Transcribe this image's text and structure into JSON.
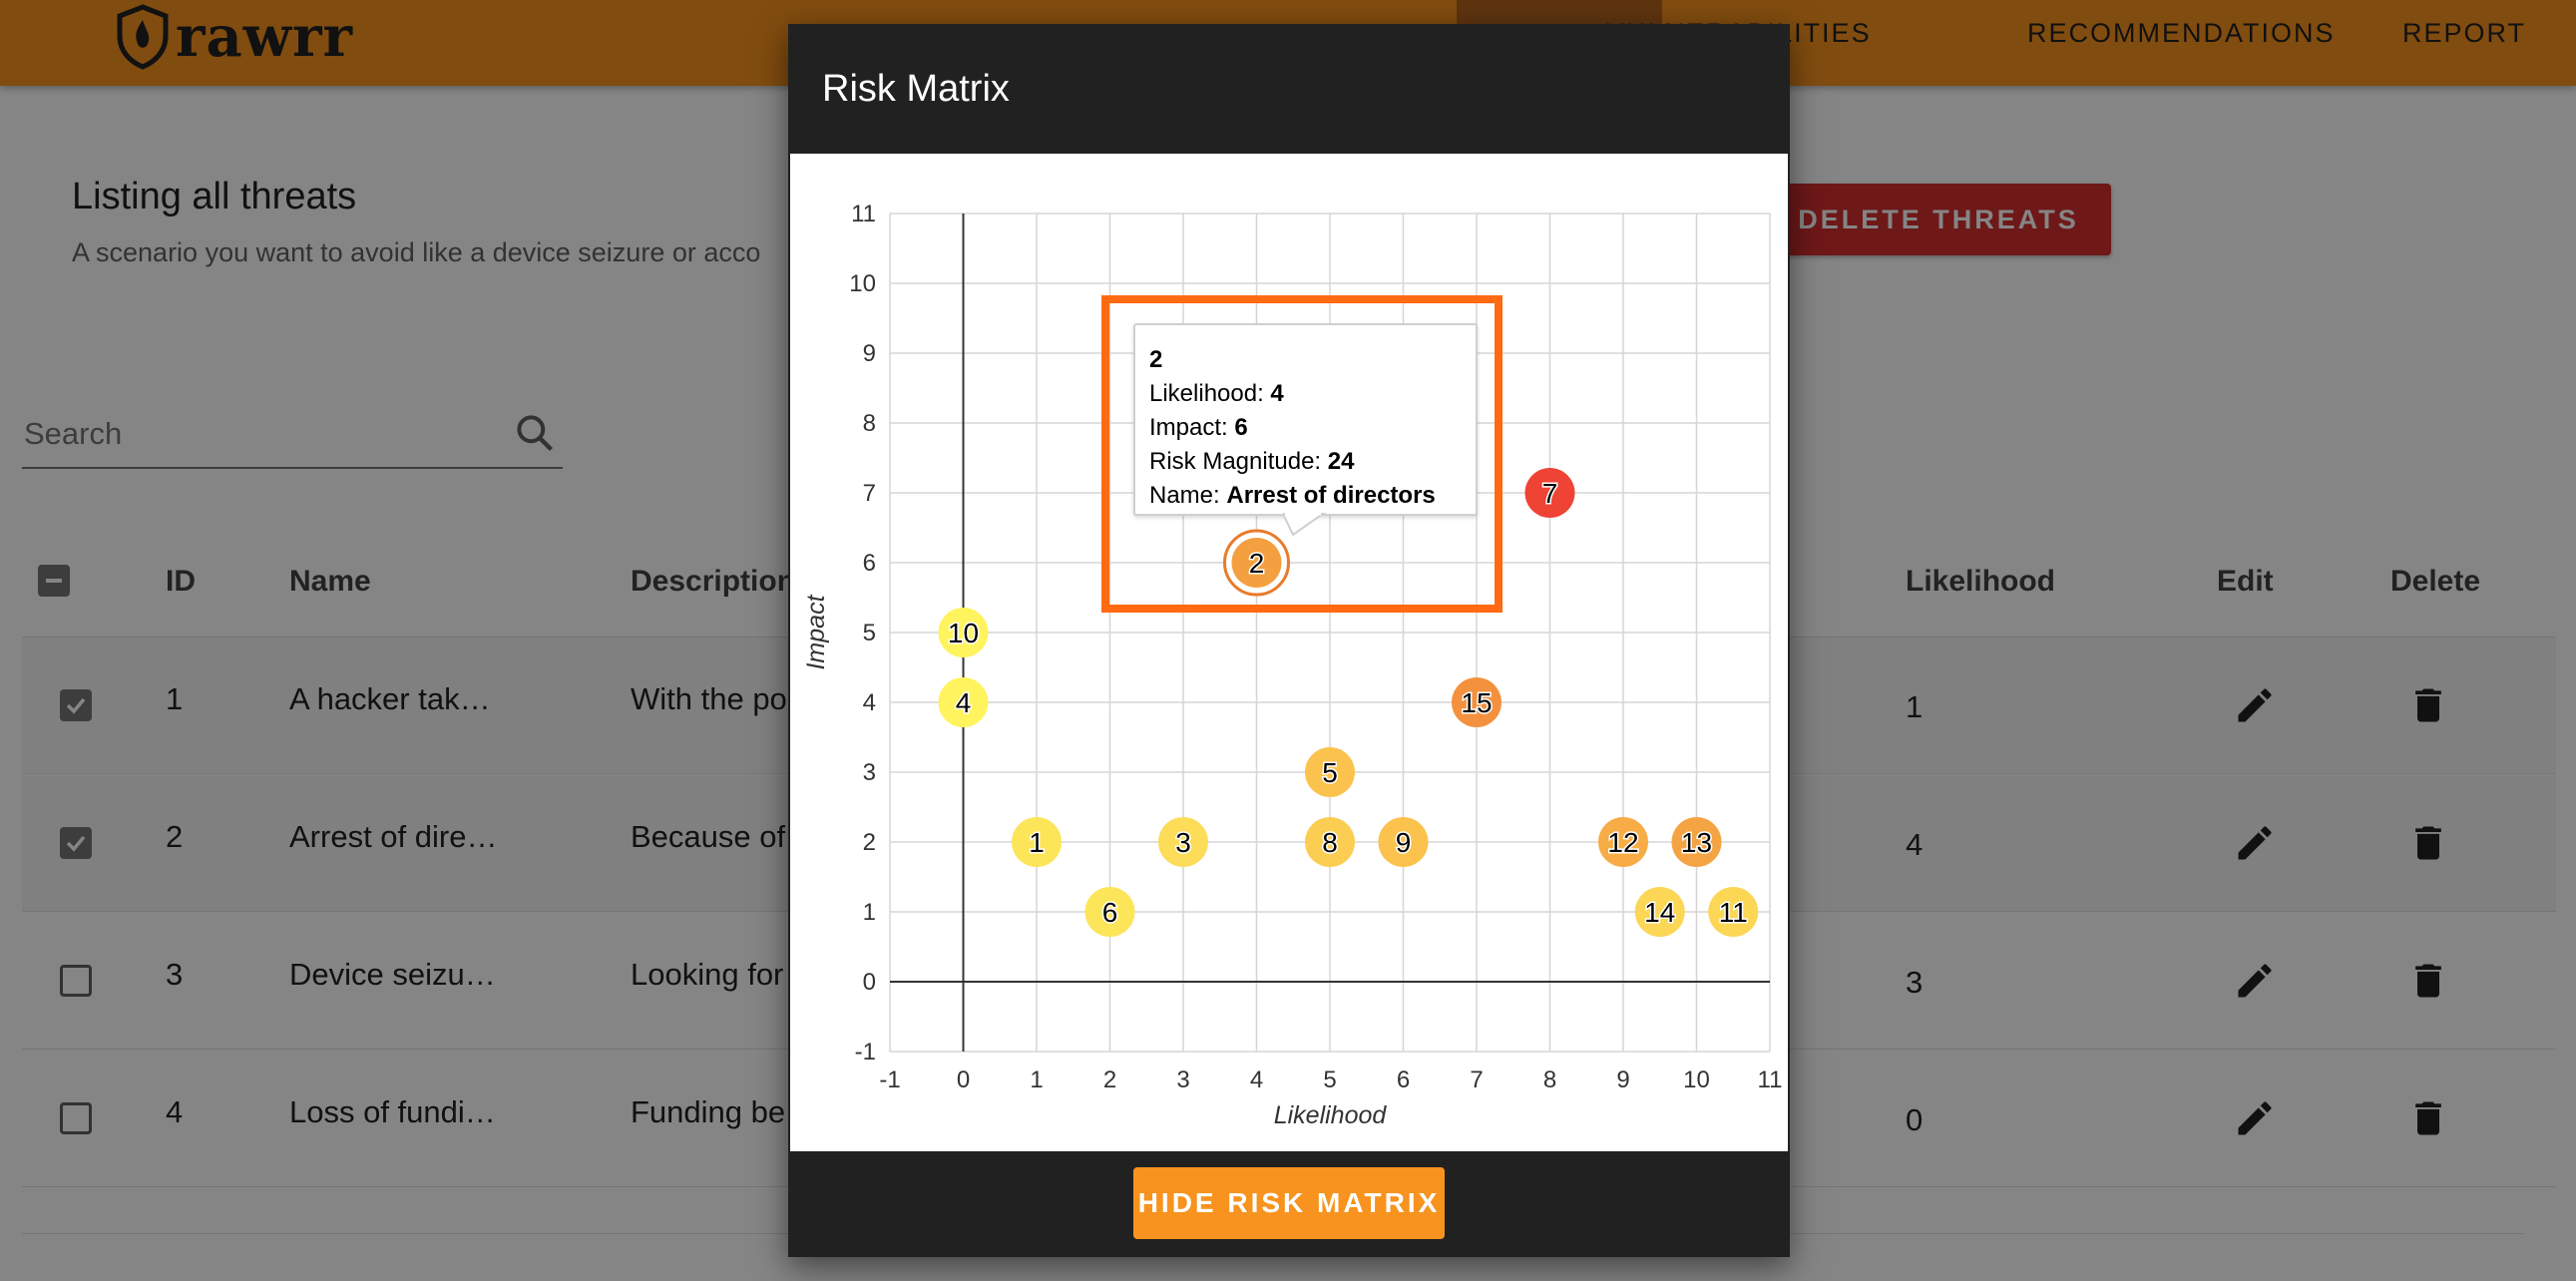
{
  "app": {
    "logo_text": "rawrr",
    "nav": [
      "VULNERABILITIES",
      "RECOMMENDATIONS",
      "REPORT"
    ]
  },
  "page": {
    "title": "Listing all threats",
    "subtitle": "A scenario you want to avoid like a device seizure or acco",
    "delete_button": "DELETE THREATS",
    "search_placeholder": "Search"
  },
  "table": {
    "headers": [
      "ID",
      "Name",
      "Description",
      "Likelihood",
      "Edit",
      "Delete"
    ],
    "rows": [
      {
        "id": "1",
        "name": "A hacker tak…",
        "description": "With the po",
        "likelihood": "1",
        "checked": true
      },
      {
        "id": "2",
        "name": "Arrest of dire…",
        "description": "Because of",
        "likelihood": "4",
        "checked": true
      },
      {
        "id": "3",
        "name": "Device seizu…",
        "description": "Looking for",
        "likelihood": "3",
        "checked": false
      },
      {
        "id": "4",
        "name": "Loss of fundi…",
        "description": "Funding be",
        "likelihood": "0",
        "checked": false
      }
    ]
  },
  "modal": {
    "title": "Risk Matrix",
    "hide_button": "HIDE RISK MATRIX",
    "tooltip": {
      "id": "2",
      "likelihood_label": "Likelihood: ",
      "likelihood": "4",
      "impact_label": "Impact: ",
      "impact": "6",
      "magnitude_label": "Risk Magnitude: ",
      "magnitude": "24",
      "name_label": "Name: ",
      "name": "Arrest of directors"
    }
  },
  "chart_data": {
    "type": "scatter",
    "xlabel": "Likelihood",
    "ylabel": "Impact",
    "xlim": [
      -1,
      11
    ],
    "ylim": [
      -1,
      11
    ],
    "xticks": [
      "-1",
      "0",
      "1",
      "2",
      "3",
      "4",
      "5",
      "6",
      "7",
      "8",
      "9",
      "10",
      "11"
    ],
    "yticks": [
      "-1",
      "0",
      "1",
      "2",
      "3",
      "4",
      "5",
      "6",
      "7",
      "8",
      "9",
      "10",
      "11"
    ],
    "grid": true,
    "points": [
      {
        "label": "1",
        "x": 1,
        "y": 2,
        "color": "#fde55a"
      },
      {
        "label": "2",
        "x": 4,
        "y": 6,
        "color": "#f4a040"
      },
      {
        "label": "3",
        "x": 3,
        "y": 2,
        "color": "#fcdc58"
      },
      {
        "label": "4",
        "x": 0,
        "y": 4,
        "color": "#fff45e"
      },
      {
        "label": "5",
        "x": 5,
        "y": 3,
        "color": "#fbc24e"
      },
      {
        "label": "6",
        "x": 2,
        "y": 1,
        "color": "#fde55a"
      },
      {
        "label": "7",
        "x": 8,
        "y": 7,
        "color": "#ef4336"
      },
      {
        "label": "8",
        "x": 5,
        "y": 2,
        "color": "#fbcd52"
      },
      {
        "label": "9",
        "x": 6,
        "y": 2,
        "color": "#fbc24e"
      },
      {
        "label": "10",
        "x": 0,
        "y": 5,
        "color": "#fff45e"
      },
      {
        "label": "11",
        "x": 10.5,
        "y": 1,
        "color": "#fcd655"
      },
      {
        "label": "12",
        "x": 9,
        "y": 2,
        "color": "#f7ac46"
      },
      {
        "label": "13",
        "x": 10,
        "y": 2,
        "color": "#f5a444"
      },
      {
        "label": "14",
        "x": 9.5,
        "y": 1,
        "color": "#fcd655"
      },
      {
        "label": "15",
        "x": 7,
        "y": 4,
        "color": "#f4913e"
      }
    ],
    "highlight_color": "#ff6a13"
  }
}
